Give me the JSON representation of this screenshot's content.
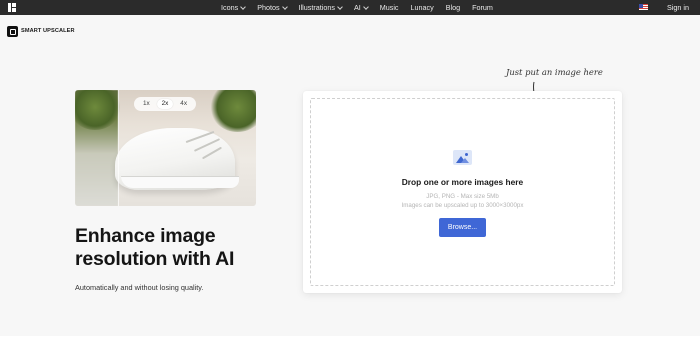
{
  "topnav": {
    "items": [
      {
        "label": "Icons",
        "dropdown": true
      },
      {
        "label": "Photos",
        "dropdown": true
      },
      {
        "label": "Illustrations",
        "dropdown": true
      },
      {
        "label": "AI",
        "dropdown": true
      },
      {
        "label": "Music",
        "dropdown": false
      },
      {
        "label": "Lunacy",
        "dropdown": false
      },
      {
        "label": "Blog",
        "dropdown": false
      },
      {
        "label": "Forum",
        "dropdown": false
      }
    ],
    "signin_label": "Sign in",
    "locale_flag": "us-flag-icon"
  },
  "brand": {
    "name": "SMART UPSCALER"
  },
  "hero": {
    "scales": [
      "1x",
      "2x",
      "4x"
    ],
    "active_scale": "2x",
    "headline_line1": "Enhance image",
    "headline_line2": "resolution with AI",
    "subline": "Automatically and without losing quality."
  },
  "upload": {
    "hint": "Just put an image here",
    "title": "Drop one or more images here",
    "note_formats": "JPG, PNG - Max size 5Mb",
    "note_resolution": "Images can be upscaled up to 3000×3000px",
    "browse_label": "Browse..."
  },
  "colors": {
    "topbar": "#2b2b2b",
    "accent": "#3f67d6",
    "background": "#f7f7f7"
  }
}
